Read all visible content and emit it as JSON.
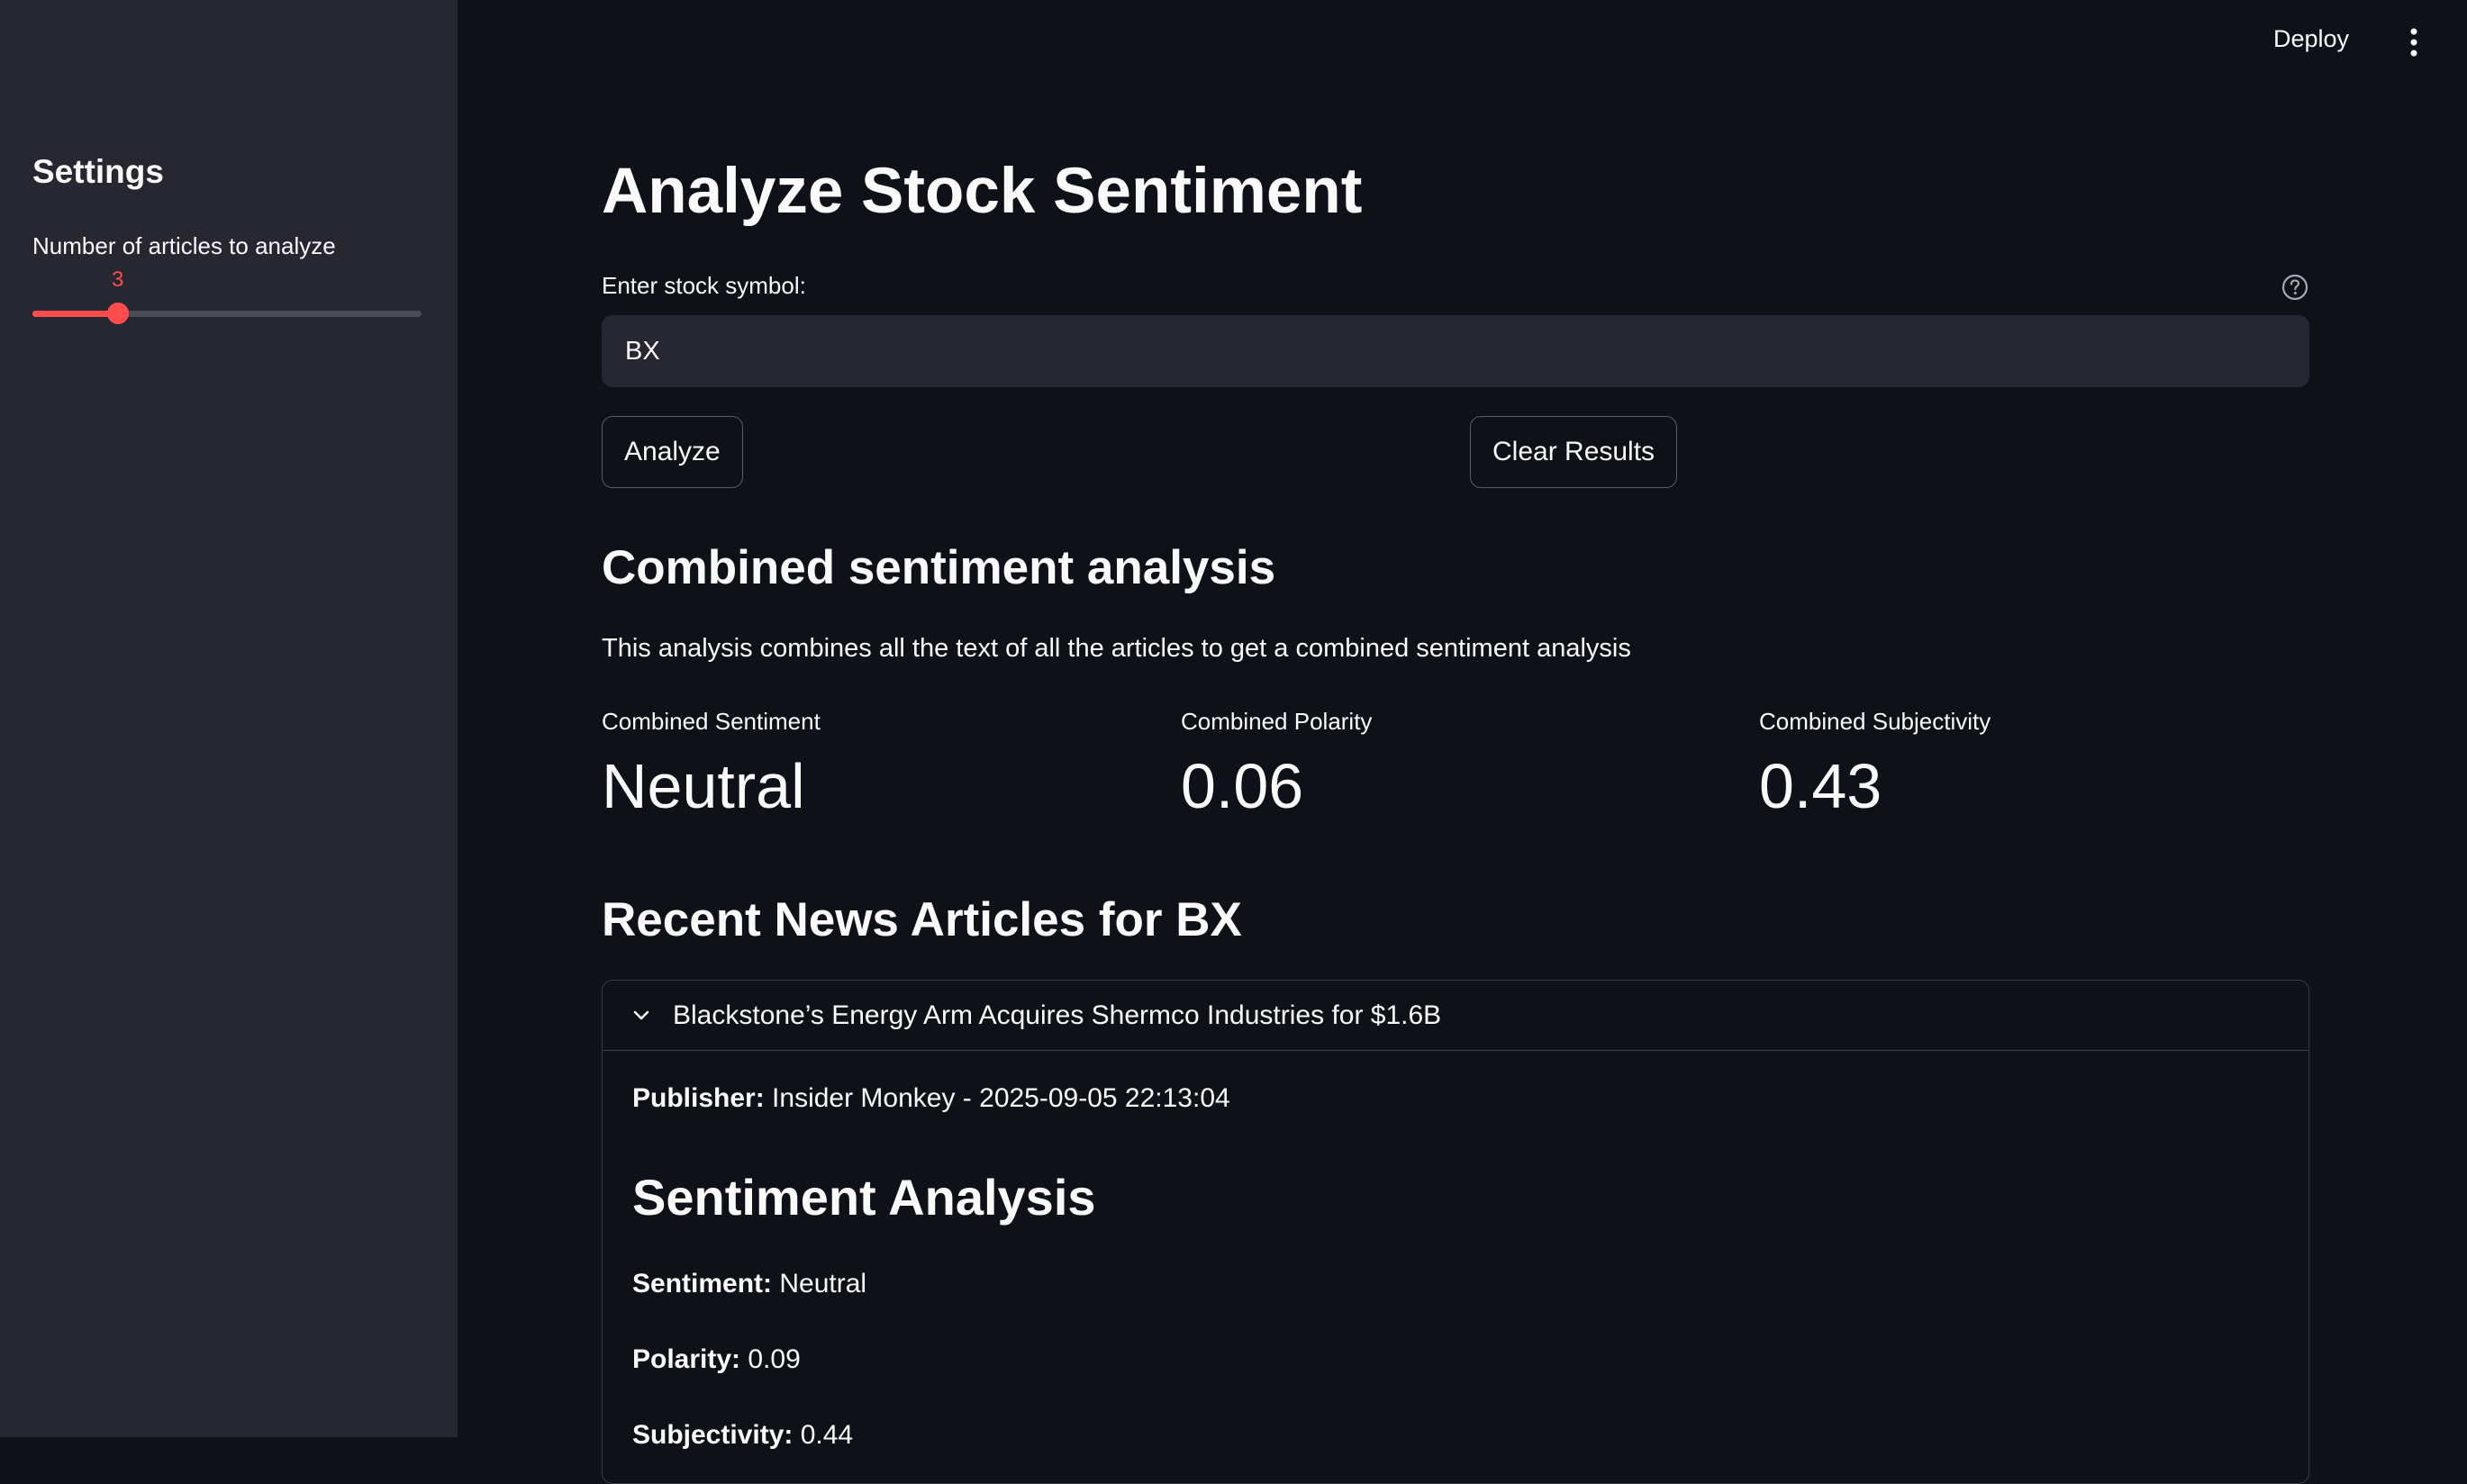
{
  "sidebar": {
    "title": "Settings",
    "slider": {
      "label": "Number of articles to analyze",
      "value": "3",
      "fraction": 0.22
    }
  },
  "header": {
    "deploy_label": "Deploy",
    "menu_icon": "vertical-ellipsis-icon"
  },
  "main": {
    "title": "Analyze Stock Sentiment",
    "input": {
      "label": "Enter stock symbol:",
      "value": "BX",
      "help_icon": "question-circle-icon"
    },
    "buttons": {
      "analyze": "Analyze",
      "clear": "Clear Results"
    },
    "combined": {
      "heading": "Combined sentiment analysis",
      "description": "This analysis combines all the text of all the articles to get a combined sentiment analysis",
      "metrics": [
        {
          "label": "Combined Sentiment",
          "value": "Neutral"
        },
        {
          "label": "Combined Polarity",
          "value": "0.06"
        },
        {
          "label": "Combined Subjectivity",
          "value": "0.43"
        }
      ]
    },
    "news": {
      "heading": "Recent News Articles for BX",
      "articles": [
        {
          "title": "Blackstone’s Energy Arm Acquires Shermco Industries for $1.6B",
          "publisher_label": "Publisher:",
          "publisher_value": "Insider Monkey - 2025-09-05 22:13:04",
          "analysis_heading": "Sentiment Analysis",
          "sentiment_label": "Sentiment:",
          "sentiment_value": "Neutral",
          "polarity_label": "Polarity:",
          "polarity_value": "0.09",
          "subjectivity_label": "Subjectivity:",
          "subjectivity_value": "0.44"
        }
      ]
    }
  },
  "colors": {
    "background": "#0e1117",
    "sidebar": "#262730",
    "accent": "#ff4b4b",
    "text": "#fafafa"
  }
}
